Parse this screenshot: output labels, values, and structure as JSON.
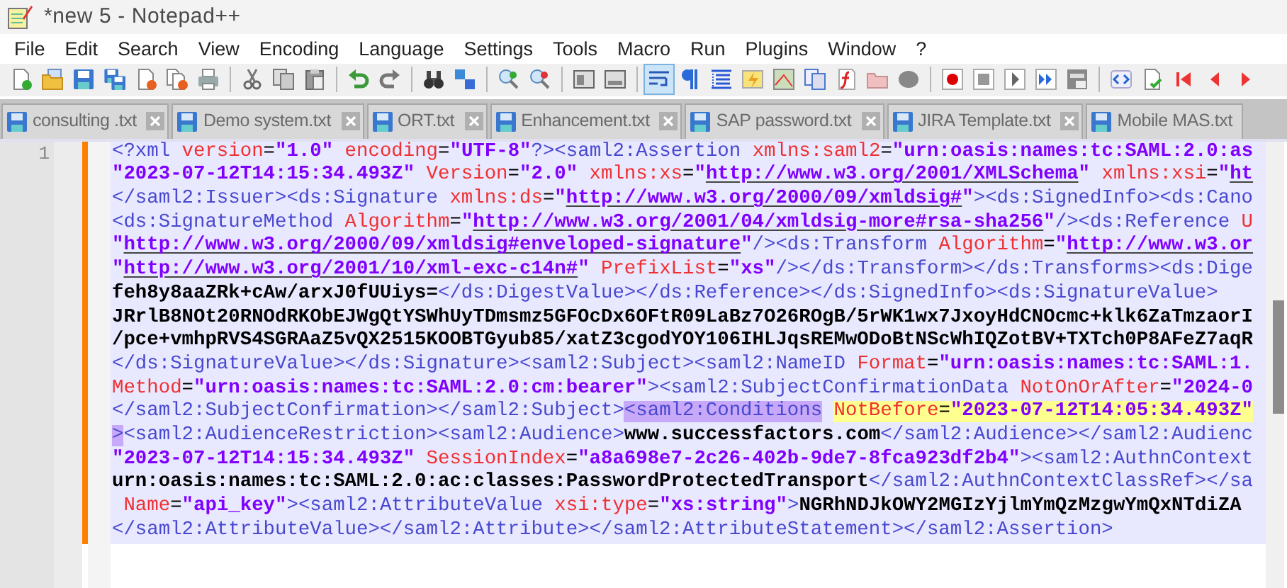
{
  "window": {
    "title": "*new 5 - Notepad++"
  },
  "menu": [
    "File",
    "Edit",
    "Search",
    "View",
    "Encoding",
    "Language",
    "Settings",
    "Tools",
    "Macro",
    "Run",
    "Plugins",
    "Window",
    "?"
  ],
  "toolbar": {
    "word_wrap": true
  },
  "tabs": [
    {
      "label": "consulting .txt",
      "selected": false,
      "cut": false
    },
    {
      "label": "Demo system.txt",
      "selected": false,
      "cut": false
    },
    {
      "label": "ORT.txt",
      "selected": false,
      "cut": false
    },
    {
      "label": "Enhancement.txt",
      "selected": false,
      "cut": false
    },
    {
      "label": "SAP password.txt",
      "selected": false,
      "cut": false
    },
    {
      "label": "JIRA Template.txt",
      "selected": false,
      "cut": false
    },
    {
      "label": "Mobile MAS.txt",
      "selected": false,
      "cut": true
    }
  ],
  "editor": {
    "line_number": "1",
    "changed": true,
    "current_line": true,
    "lines": [
      [
        {
          "kind": "tag",
          "text": "<?xml"
        },
        {
          "kind": "attr",
          "text": " version"
        },
        {
          "kind": "eq",
          "text": "="
        },
        {
          "kind": "value",
          "text": "\"1.0\""
        },
        {
          "kind": "attr",
          "text": " encoding"
        },
        {
          "kind": "eq",
          "text": "="
        },
        {
          "kind": "value",
          "text": "\"UTF-8\""
        },
        {
          "kind": "tag",
          "text": "?><saml2:Assertion"
        },
        {
          "kind": "attr",
          "text": " xmlns:saml2"
        },
        {
          "kind": "eq",
          "text": "="
        },
        {
          "kind": "value",
          "text": "\"urn:oasis:names:tc:SAML:2.0:as"
        }
      ],
      [
        {
          "kind": "value",
          "text": "\"2023-07-12T14:15:34.493Z\""
        },
        {
          "kind": "attr",
          "text": " Version"
        },
        {
          "kind": "eq",
          "text": "="
        },
        {
          "kind": "value",
          "text": "\"2.0\""
        },
        {
          "kind": "attr",
          "text": " xmlns:xs"
        },
        {
          "kind": "eq",
          "text": "="
        },
        {
          "kind": "value",
          "text": "\""
        },
        {
          "kind": "url",
          "text": "http://www.w3.org/2001/XMLSchema"
        },
        {
          "kind": "value",
          "text": "\""
        },
        {
          "kind": "attr",
          "text": " xmlns:xsi"
        },
        {
          "kind": "eq",
          "text": "="
        },
        {
          "kind": "value",
          "text": "\""
        },
        {
          "kind": "url",
          "text": "ht"
        }
      ],
      [
        {
          "kind": "tag",
          "text": "</saml2:Issuer><ds:Signature"
        },
        {
          "kind": "attr",
          "text": " xmlns:ds"
        },
        {
          "kind": "eq",
          "text": "="
        },
        {
          "kind": "value",
          "text": "\""
        },
        {
          "kind": "url",
          "text": "http://www.w3.org/2000/09/xmldsig#"
        },
        {
          "kind": "value",
          "text": "\""
        },
        {
          "kind": "tag",
          "text": "><ds:SignedInfo><ds:Cano"
        }
      ],
      [
        {
          "kind": "tag",
          "text": "<ds:SignatureMethod"
        },
        {
          "kind": "attr",
          "text": " Algorithm"
        },
        {
          "kind": "eq",
          "text": "="
        },
        {
          "kind": "value",
          "text": "\""
        },
        {
          "kind": "url",
          "text": "http://www.w3.org/2001/04/xmldsig-more#rsa-sha256"
        },
        {
          "kind": "value",
          "text": "\""
        },
        {
          "kind": "tag",
          "text": "/><ds:Reference"
        },
        {
          "kind": "attr",
          "text": " U"
        }
      ],
      [
        {
          "kind": "value",
          "text": "\""
        },
        {
          "kind": "url",
          "text": "http://www.w3.org/2000/09/xmldsig#enveloped-signature"
        },
        {
          "kind": "value",
          "text": "\""
        },
        {
          "kind": "tag",
          "text": "/><ds:Transform"
        },
        {
          "kind": "attr",
          "text": " Algorithm"
        },
        {
          "kind": "eq",
          "text": "="
        },
        {
          "kind": "value",
          "text": "\""
        },
        {
          "kind": "url",
          "text": "http://www.w3.or"
        }
      ],
      [
        {
          "kind": "value",
          "text": "\""
        },
        {
          "kind": "url",
          "text": "http://www.w3.org/2001/10/xml-exc-c14n#"
        },
        {
          "kind": "value",
          "text": "\""
        },
        {
          "kind": "attr",
          "text": " PrefixList"
        },
        {
          "kind": "eq",
          "text": "="
        },
        {
          "kind": "value",
          "text": "\"xs\""
        },
        {
          "kind": "tag",
          "text": "/></ds:Transform></ds:Transforms><ds:Dige"
        }
      ],
      [
        {
          "kind": "text",
          "text": "feh8y8aaZRk+cAw/arxJ0fUUiys="
        },
        {
          "kind": "tag",
          "text": "</ds:DigestValue></ds:Reference></ds:SignedInfo><ds:SignatureValue>"
        }
      ],
      [
        {
          "kind": "text",
          "text": "JRrlB8NOt20RNOdRKObEJWgQtYSWhUyTDmsmz5GFOcDx6OFtR09LaBz7O26ROgB/5rWK1wx7JxoyHdCNOcmc+klk6ZaTmzaorI"
        }
      ],
      [
        {
          "kind": "text",
          "text": "/pce+vmhpRVS4SGRAaZ5vQX2515KOOBTGyub85/xatZ3cgodYOY106IHLJqsREMwODoBtNScWhIQZotBV+TXTch0P8AFeZ7aqR"
        }
      ],
      [
        {
          "kind": "tag",
          "text": "</ds:SignatureValue></ds:Signature><saml2:Subject><saml2:NameID"
        },
        {
          "kind": "attr",
          "text": " Format"
        },
        {
          "kind": "eq",
          "text": "="
        },
        {
          "kind": "value",
          "text": "\"urn:oasis:names:tc:SAML:1."
        }
      ],
      [
        {
          "kind": "attr",
          "text": "Method"
        },
        {
          "kind": "eq",
          "text": "="
        },
        {
          "kind": "value",
          "text": "\"urn:oasis:names:tc:SAML:2.0:cm:bearer\""
        },
        {
          "kind": "tag",
          "text": "><saml2:SubjectConfirmationData"
        },
        {
          "kind": "attr",
          "text": " NotOnOrAfter"
        },
        {
          "kind": "eq",
          "text": "="
        },
        {
          "kind": "value",
          "text": "\"2024-0"
        }
      ],
      [
        {
          "kind": "tag",
          "text": "</saml2:SubjectConfirmation></saml2:Subject>"
        },
        {
          "kind": "tag",
          "text": "<saml2:Conditions",
          "matched": true
        },
        {
          "kind": "attr",
          "text": " NotBefore",
          "found": true
        },
        {
          "kind": "eq",
          "text": "=",
          "found": true
        },
        {
          "kind": "value",
          "text": "\"2023-07-12T14:05:34.493Z\"",
          "found": true
        }
      ],
      [
        {
          "kind": "tag",
          "text": ">",
          "matched": true
        },
        {
          "kind": "tag",
          "text": "<saml2:AudienceRestriction><saml2:Audience>"
        },
        {
          "kind": "text",
          "text": "www.successfactors.com"
        },
        {
          "kind": "tag",
          "text": "</saml2:Audience></saml2:Audienc"
        }
      ],
      [
        {
          "kind": "value",
          "text": "\"2023-07-12T14:15:34.493Z\""
        },
        {
          "kind": "attr",
          "text": " SessionIndex"
        },
        {
          "kind": "eq",
          "text": "="
        },
        {
          "kind": "value",
          "text": "\"a8a698e7-2c26-402b-9de7-8fca923df2b4\""
        },
        {
          "kind": "tag",
          "text": "><saml2:AuthnContext"
        }
      ],
      [
        {
          "kind": "text",
          "text": "urn:oasis:names:tc:SAML:2.0:ac:classes:PasswordProtectedTransport"
        },
        {
          "kind": "tag",
          "text": "</saml2:AuthnContextClassRef></sa"
        }
      ],
      [
        {
          "kind": "attr",
          "text": " Name"
        },
        {
          "kind": "eq",
          "text": "="
        },
        {
          "kind": "value",
          "text": "\"api_key\""
        },
        {
          "kind": "tag",
          "text": "><saml2:AttributeValue"
        },
        {
          "kind": "attr",
          "text": " xsi:type"
        },
        {
          "kind": "eq",
          "text": "="
        },
        {
          "kind": "value",
          "text": "\"xs:string\""
        },
        {
          "kind": "tag",
          "text": ">"
        },
        {
          "kind": "text",
          "text": "NGRhNDJkOWY2MGIzYjlmYmQzMzgwYmQxNTdiZA"
        }
      ],
      [
        {
          "kind": "tag",
          "text": "</saml2:AttributeValue></saml2:Attribute></saml2:AttributeStatement></saml2:Assertion>"
        }
      ]
    ]
  }
}
